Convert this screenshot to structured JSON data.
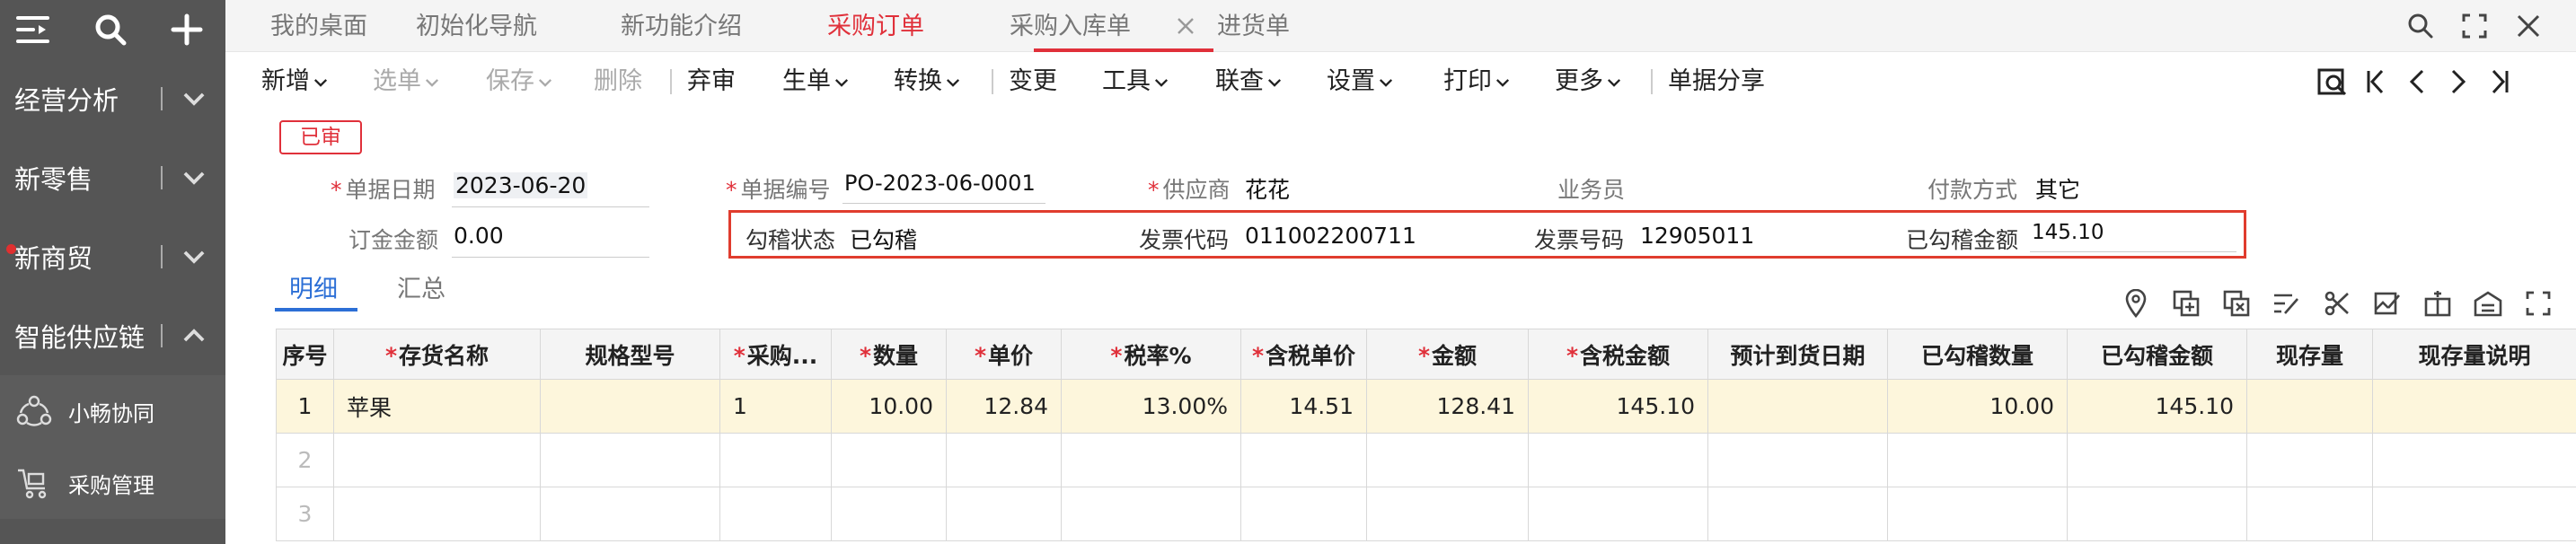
{
  "sidebar": {
    "nav": [
      {
        "label": "经营分析",
        "state": "collapsed"
      },
      {
        "label": "新零售",
        "state": "collapsed"
      },
      {
        "label": "新商贸",
        "state": "collapsed",
        "dot": true
      },
      {
        "label": "智能供应链",
        "state": "expanded"
      }
    ],
    "sub": [
      {
        "label": "小畅协同",
        "icon": "collab-icon"
      },
      {
        "label": "采购管理",
        "icon": "cart-icon"
      }
    ]
  },
  "tabs": [
    {
      "label": "我的桌面"
    },
    {
      "label": "初始化导航"
    },
    {
      "label": "新功能介绍"
    },
    {
      "label": "采购订单",
      "active": true
    },
    {
      "label": "采购入库单"
    },
    {
      "label": "进货单"
    }
  ],
  "toolbar": {
    "items": [
      {
        "label": "新增",
        "dropdown": true
      },
      {
        "label": "选单",
        "dropdown": true,
        "disabled": true
      },
      {
        "label": "保存",
        "dropdown": true,
        "disabled": true
      },
      {
        "label": "删除",
        "disabled": true
      },
      {
        "label": "弃审"
      },
      {
        "label": "生单",
        "dropdown": true
      },
      {
        "label": "转换",
        "dropdown": true
      },
      {
        "label": "变更"
      },
      {
        "label": "工具",
        "dropdown": true
      },
      {
        "label": "联查",
        "dropdown": true
      },
      {
        "label": "设置",
        "dropdown": true
      },
      {
        "label": "打印",
        "dropdown": true
      },
      {
        "label": "更多",
        "dropdown": true
      },
      {
        "label": "单据分享"
      }
    ]
  },
  "status_badge": "已审",
  "form": {
    "doc_date": {
      "label": "单据日期",
      "value": "2023-06-20"
    },
    "doc_no": {
      "label": "单据编号",
      "value": "PO-2023-06-0001"
    },
    "supplier": {
      "label": "供应商",
      "value": "花花"
    },
    "salesman": {
      "label": "业务员",
      "value": ""
    },
    "payment": {
      "label": "付款方式",
      "value": "其它"
    },
    "deposit": {
      "label": "订金金额",
      "value": "0.00"
    },
    "verify_status": {
      "label": "勾稽状态",
      "value": "已勾稽"
    },
    "invoice_code": {
      "label": "发票代码",
      "value": "011002200711"
    },
    "invoice_no": {
      "label": "发票号码",
      "value": "12905011"
    },
    "verified_amount": {
      "label": "已勾稽金额",
      "value": "145.10"
    }
  },
  "detail_tabs": [
    {
      "label": "明细",
      "active": true
    },
    {
      "label": "汇总"
    }
  ],
  "grid": {
    "columns": [
      {
        "label": "序号",
        "required": false
      },
      {
        "label": "存货名称",
        "required": true
      },
      {
        "label": "规格型号",
        "required": false
      },
      {
        "label": "采购...",
        "required": true
      },
      {
        "label": "数量",
        "required": true
      },
      {
        "label": "单价",
        "required": true
      },
      {
        "label": "税率%",
        "required": true
      },
      {
        "label": "含税单价",
        "required": true
      },
      {
        "label": "金额",
        "required": true
      },
      {
        "label": "含税金额",
        "required": true
      },
      {
        "label": "预计到货日期",
        "required": false
      },
      {
        "label": "已勾稽数量",
        "required": false
      },
      {
        "label": "已勾稽金额",
        "required": false
      },
      {
        "label": "现存量",
        "required": false
      },
      {
        "label": "现存量说明",
        "required": false
      }
    ],
    "rows": [
      [
        "1",
        "苹果",
        "",
        "1",
        "10.00",
        "12.84",
        "13.00%",
        "14.51",
        "128.41",
        "145.10",
        "",
        "10.00",
        "145.10",
        "",
        ""
      ],
      [
        "2",
        "",
        "",
        "",
        "",
        "",
        "",
        "",
        "",
        "",
        "",
        "",
        "",
        "",
        ""
      ],
      [
        "3",
        "",
        "",
        "",
        "",
        "",
        "",
        "",
        "",
        "",
        "",
        "",
        "",
        "",
        ""
      ]
    ]
  },
  "colors": {
    "accent_red": "#e0303a",
    "accent_blue": "#2c6fd6",
    "sidebar_bg": "#555555"
  }
}
